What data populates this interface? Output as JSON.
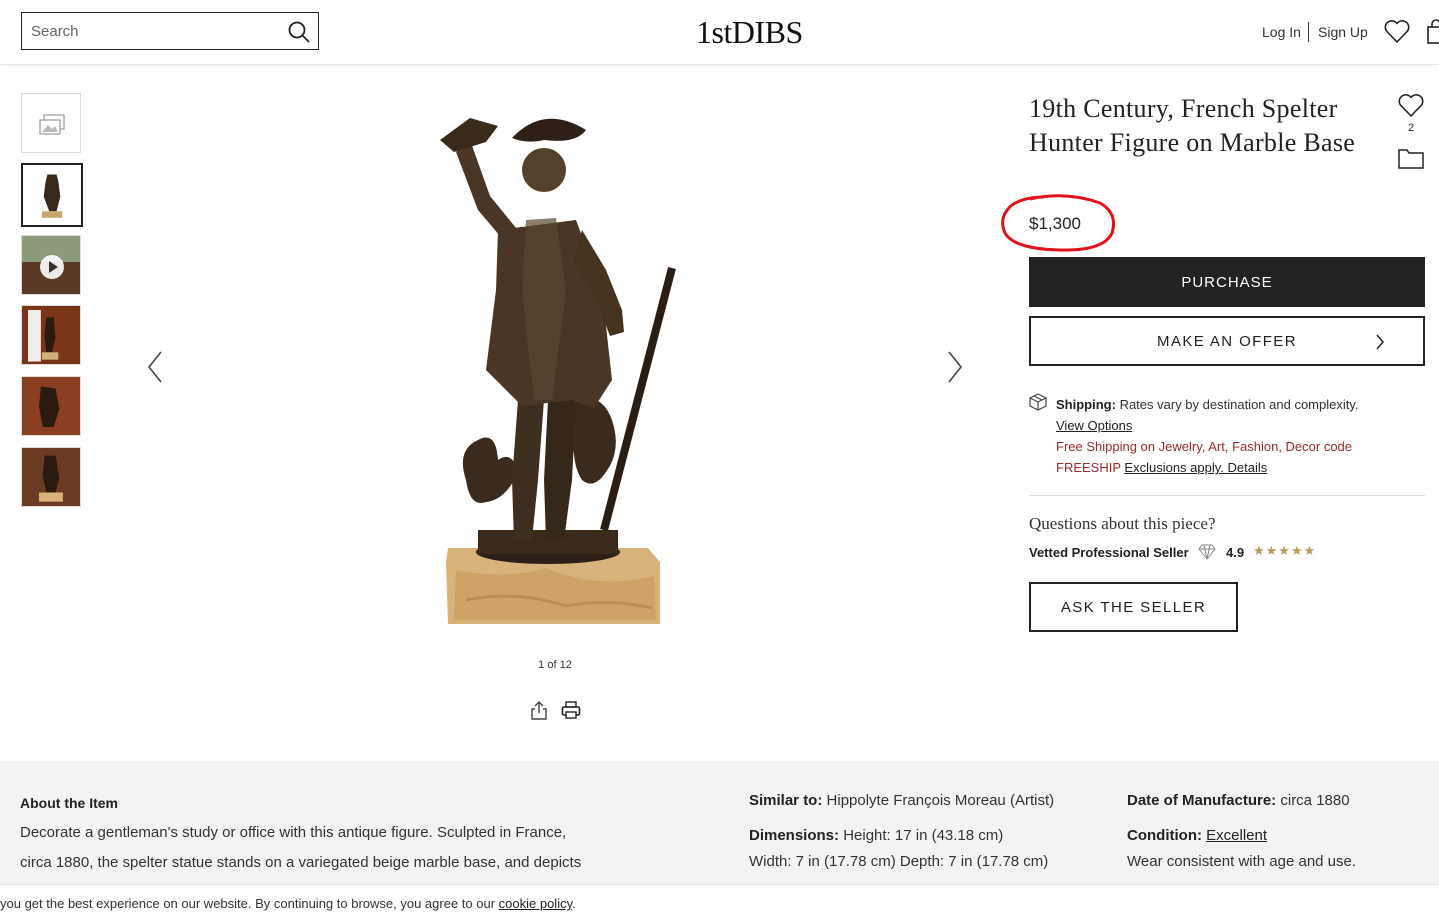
{
  "header": {
    "search_placeholder": "Search",
    "logo": "1stDIBS",
    "login": "Log In",
    "signup": "Sign Up"
  },
  "gallery": {
    "counter": "1 of 12",
    "thumbnail_count": 6,
    "selected_thumbnail": 2
  },
  "product": {
    "title": "19th Century, French Spelter Hunter Figure on Marble Base",
    "favorites_count": "2",
    "price": "$1,300",
    "purchase_label": "PURCHASE",
    "offer_label": "MAKE AN OFFER",
    "shipping": {
      "label": "Shipping:",
      "text": "Rates vary by destination and complexity.",
      "view_options": "View Options",
      "promo": "Free Shipping on Jewelry, Art, Fashion, Decor code FREESHIP",
      "exclusions": "Exclusions apply. Details"
    },
    "questions": "Questions about this piece?",
    "seller_badge": "Vetted Professional Seller",
    "rating": "4.9",
    "stars": "★★★★★",
    "ask_label": "ASK THE SELLER"
  },
  "details": {
    "about_heading": "About the Item",
    "about_line1": "Decorate a gentleman's study or office with this antique figure. Sculpted in France,",
    "about_line2": "circa 1880, the spelter statue stands on a variegated beige marble base, and depicts",
    "similar_label": "Similar to:",
    "similar_value": "Hippolyte François Moreau (Artist)",
    "dimensions_label": "Dimensions:",
    "dimensions_line1": "Height: 17 in (43.18 cm)",
    "dimensions_line2": "Width: 7 in (17.78 cm) Depth: 7 in (17.78 cm)",
    "date_label": "Date of Manufacture:",
    "date_value": "circa 1880",
    "condition_label": "Condition:",
    "condition_value": "Excellent",
    "condition_note": "Wear consistent with age and use."
  },
  "cookie": {
    "text": "you get the best experience on our website. By continuing to browse, you agree to our",
    "link": "cookie policy",
    "end": "."
  },
  "colors": {
    "accent_dark": "#222222",
    "price_circle": "#e0121b",
    "promo_red": "#9b2a2a",
    "star_gold": "#b89a5a"
  }
}
